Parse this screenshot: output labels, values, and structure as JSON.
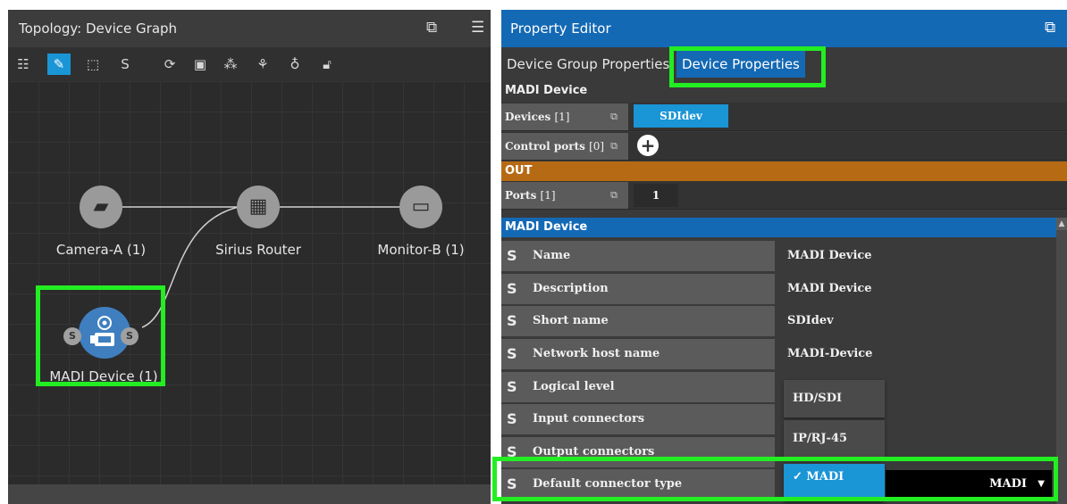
{
  "left_panel": {
    "title": "Topology: Device Graph",
    "title_icons": [
      "popout-icon",
      "menu-icon"
    ],
    "toolbar": [
      "list-icon",
      "pencil-icon",
      "select-icon",
      "link-icon",
      "refresh-icon",
      "bucket-icon",
      "cluster-icon",
      "tree-icon",
      "bulb-icon",
      "lock-icon"
    ],
    "nodes": [
      {
        "label": "Camera-A (1)",
        "icon": "camera-icon"
      },
      {
        "label": "Sirius Router",
        "icon": "router-grid-icon"
      },
      {
        "label": "Monitor-B (1)",
        "icon": "monitor-icon"
      },
      {
        "label": "MADI Device (1)",
        "icon": "madi-device-icon"
      }
    ]
  },
  "right_panel": {
    "title": "Property Editor",
    "tabs": [
      {
        "label": "Device Group Properties",
        "active": false
      },
      {
        "label": "Device Properties",
        "active": true
      }
    ],
    "group_header": "MADI Device",
    "devices": {
      "label": "Devices",
      "count": "[1]",
      "value": "SDIdev"
    },
    "control_ports": {
      "label": "Control ports",
      "count": "[0]"
    },
    "out_header": "OUT",
    "ports": {
      "label": "Ports",
      "count": "[1]",
      "value": "1"
    },
    "device_section": "MADI Device",
    "properties": [
      {
        "name": "Name",
        "value": "MADI Device"
      },
      {
        "name": "Description",
        "value": "MADI Device"
      },
      {
        "name": "Short name",
        "value": "SDIdev"
      },
      {
        "name": "Network host name",
        "value": "MADI-Device"
      },
      {
        "name": "Logical level",
        "value": ""
      },
      {
        "name": "Input connectors",
        "value": ""
      },
      {
        "name": "Output connectors",
        "value": ""
      },
      {
        "name": "Default connector type",
        "value": ""
      }
    ],
    "dropdown": {
      "options": [
        "HD/SDI",
        "IP/RJ-45",
        "MADI"
      ],
      "selected_mark": "✓ MADI",
      "current": "MADI"
    }
  },
  "colors": {
    "accent_blue": "#1469b4",
    "highlight_blue": "#1a95d6",
    "out_orange": "#b76a14",
    "annotation_green": "#22ee22"
  }
}
